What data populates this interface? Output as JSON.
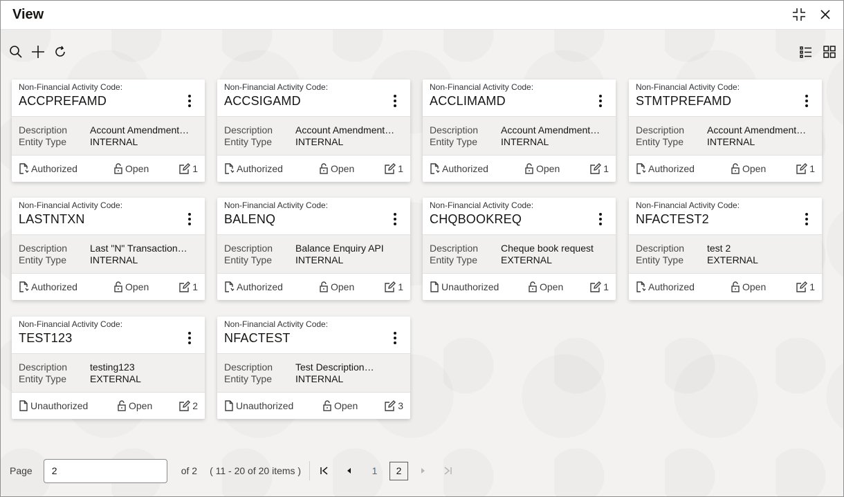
{
  "window": {
    "title": "View"
  },
  "toolbar": {
    "search_icon": "search-icon",
    "add_icon": "plus-icon",
    "refresh_icon": "refresh-icon",
    "list_view_icon": "list-view-icon",
    "grid_view_icon": "grid-view-icon"
  },
  "code_label": "Non-Financial Activity Code:",
  "desc_label": "Description",
  "entity_label": "Entity Type",
  "cards": [
    {
      "code": "ACCPREFAMD",
      "description": "Account Amendment…",
      "entity_type": "INTERNAL",
      "auth": "Authorized",
      "lock": "Open",
      "mod": "1"
    },
    {
      "code": "ACCSIGAMD",
      "description": "Account Amendment…",
      "entity_type": "INTERNAL",
      "auth": "Authorized",
      "lock": "Open",
      "mod": "1"
    },
    {
      "code": "ACCLIMAMD",
      "description": "Account Amendment…",
      "entity_type": "INTERNAL",
      "auth": "Authorized",
      "lock": "Open",
      "mod": "1"
    },
    {
      "code": "STMTPREFAMD",
      "description": "Account Amendment…",
      "entity_type": "INTERNAL",
      "auth": "Authorized",
      "lock": "Open",
      "mod": "1"
    },
    {
      "code": "LASTNTXN",
      "description": "Last \"N\" Transaction…",
      "entity_type": "INTERNAL",
      "auth": "Authorized",
      "lock": "Open",
      "mod": "1"
    },
    {
      "code": "BALENQ",
      "description": "Balance Enquiry API",
      "entity_type": "INTERNAL",
      "auth": "Authorized",
      "lock": "Open",
      "mod": "1"
    },
    {
      "code": "CHQBOOKREQ",
      "description": "Cheque book request",
      "entity_type": "EXTERNAL",
      "auth": "Unauthorized",
      "lock": "Open",
      "mod": "1"
    },
    {
      "code": "NFACTEST2",
      "description": "test 2",
      "entity_type": "EXTERNAL",
      "auth": "Authorized",
      "lock": "Open",
      "mod": "1"
    },
    {
      "code": "TEST123",
      "description": "testing123",
      "entity_type": "EXTERNAL",
      "auth": "Unauthorized",
      "lock": "Open",
      "mod": "2"
    },
    {
      "code": "NFACTEST",
      "description": "Test Description…",
      "entity_type": "INTERNAL",
      "auth": "Unauthorized",
      "lock": "Open",
      "mod": "3"
    }
  ],
  "pager": {
    "page_label": "Page",
    "page_value": "2",
    "of_label": "of 2",
    "range_label": "( 11 - 20 of 20 items )",
    "pages": [
      "1",
      "2"
    ],
    "current_page": "2"
  }
}
